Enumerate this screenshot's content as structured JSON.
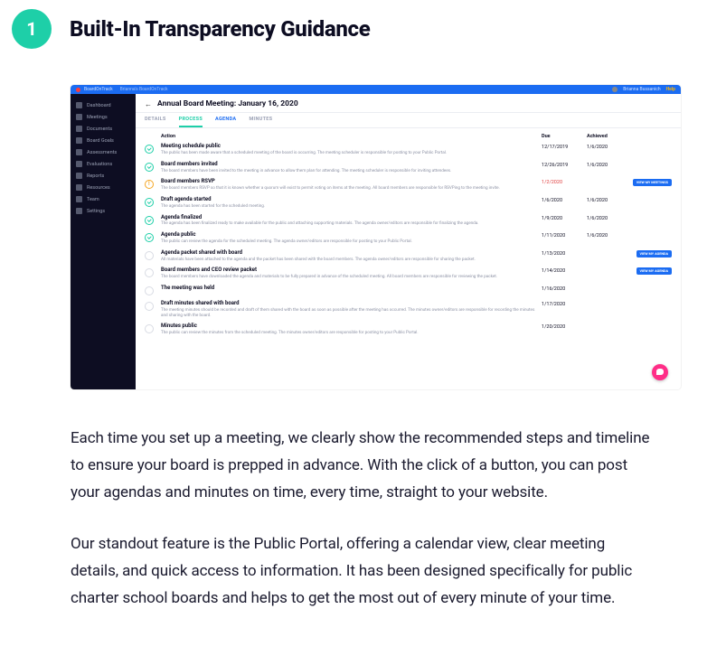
{
  "heading": {
    "number": "1",
    "title": "Built-In Transparency Guidance"
  },
  "paragraphs": [
    "Each time you set up a meeting, we clearly show the recommended steps and timeline to ensure your board is prepped in advance. With the click of a button, you can post your agendas and minutes on time, every time, straight to your website.",
    "Our standout feature is the Public Portal, offering a calendar view, clear meeting details, and quick access to information. It has been designed specifically for public charter school boards and helps to get the most out of every minute of your time."
  ],
  "app": {
    "topbar": {
      "brand": "BoardOnTrack",
      "workspace": "Brianna's BoardOnTrack",
      "user": "Brianna Bussanich",
      "help": "Help"
    },
    "sidebar": [
      "Dashboard",
      "Meetings",
      "Documents",
      "Board Goals",
      "Assessments",
      "Evaluations",
      "Reports",
      "Resources",
      "Team",
      "Settings"
    ],
    "panel": {
      "title": "Annual Board Meeting: January 16, 2020",
      "tabs": [
        "DETAILS",
        "PROCESS",
        "AGENDA",
        "MINUTES"
      ],
      "active_tab": 1,
      "columns": {
        "action": "Action",
        "due": "Due",
        "achieved": "Achieved"
      },
      "buttons": {
        "view_meetings": "VIEW MY MEETINGS",
        "view_agenda": "VIEW MY AGENDA"
      },
      "actions": [
        {
          "status": "done",
          "title": "Meeting schedule public",
          "desc": "The public has been made aware that a scheduled meeting of the board is occurring. The meeting scheduler is responsible for posting to your Public Portal.",
          "due": "12/17/2019",
          "achieved": "1/6/2020",
          "buttons": []
        },
        {
          "status": "done",
          "title": "Board members invited",
          "desc": "The board members have been invited to the meeting in advance to allow them plan for attending. The meeting scheduler is responsible for inviting attendees.",
          "due": "12/26/2019",
          "achieved": "1/6/2020",
          "buttons": []
        },
        {
          "status": "warn",
          "title": "Board members RSVP",
          "desc": "The board members RSVP so that it is known whether a quorum will exist to permit voting on items at the meeting. All board members are responsible for RSVPing to the meeting invite.",
          "due": "1/2/2020",
          "due_overdue": true,
          "achieved": "",
          "buttons": [
            "view_meetings"
          ]
        },
        {
          "status": "done",
          "title": "Draft agenda started",
          "desc": "The agenda has been started for the scheduled meeting.",
          "due": "1/6/2020",
          "achieved": "1/6/2020",
          "buttons": []
        },
        {
          "status": "done",
          "title": "Agenda finalized",
          "desc": "The agenda has been finalized ready to make available for the public and attaching supporting materials. The agenda owner/editors are responsible for finalizing the agenda.",
          "due": "1/9/2020",
          "achieved": "1/6/2020",
          "buttons": []
        },
        {
          "status": "done",
          "title": "Agenda public",
          "desc": "The public can review the agenda for the scheduled meeting. The agenda owner/editors are responsible for posting to your Public Portal.",
          "due": "1/11/2020",
          "achieved": "1/6/2020",
          "buttons": []
        },
        {
          "status": "pending",
          "title": "Agenda packet shared with board",
          "desc": "All materials have been attached to the agenda and the packet has been shared with the board members. The agenda owner/editors are responsible for sharing the packet.",
          "due": "1/13/2020",
          "achieved": "",
          "buttons": [
            "view_agenda"
          ]
        },
        {
          "status": "pending",
          "title": "Board members and CEO review packet",
          "desc": "The board members have downloaded the agenda and materials to be fully prepared in advance of the scheduled meeting. All board members are responsible for reviewing the packet.",
          "due": "1/14/2020",
          "achieved": "",
          "buttons": [
            "view_agenda"
          ]
        },
        {
          "status": "pending",
          "title": "The meeting was held",
          "desc": "",
          "due": "1/16/2020",
          "achieved": "",
          "buttons": []
        },
        {
          "status": "pending",
          "title": "Draft minutes shared with board",
          "desc": "The meeting minutes should be recorded and draft of them shared with the board as soon as possible after the meeting has occurred. The minutes owner/editors are responsible for recording the minutes and sharing with the board.",
          "due": "1/17/2020",
          "achieved": "",
          "buttons": []
        },
        {
          "status": "pending",
          "title": "Minutes public",
          "desc": "The public can review the minutes from the scheduled meeting. The minutes owner/editors are responsible for posting to your Public Portal.",
          "due": "1/20/2020",
          "achieved": "",
          "buttons": []
        }
      ]
    }
  }
}
